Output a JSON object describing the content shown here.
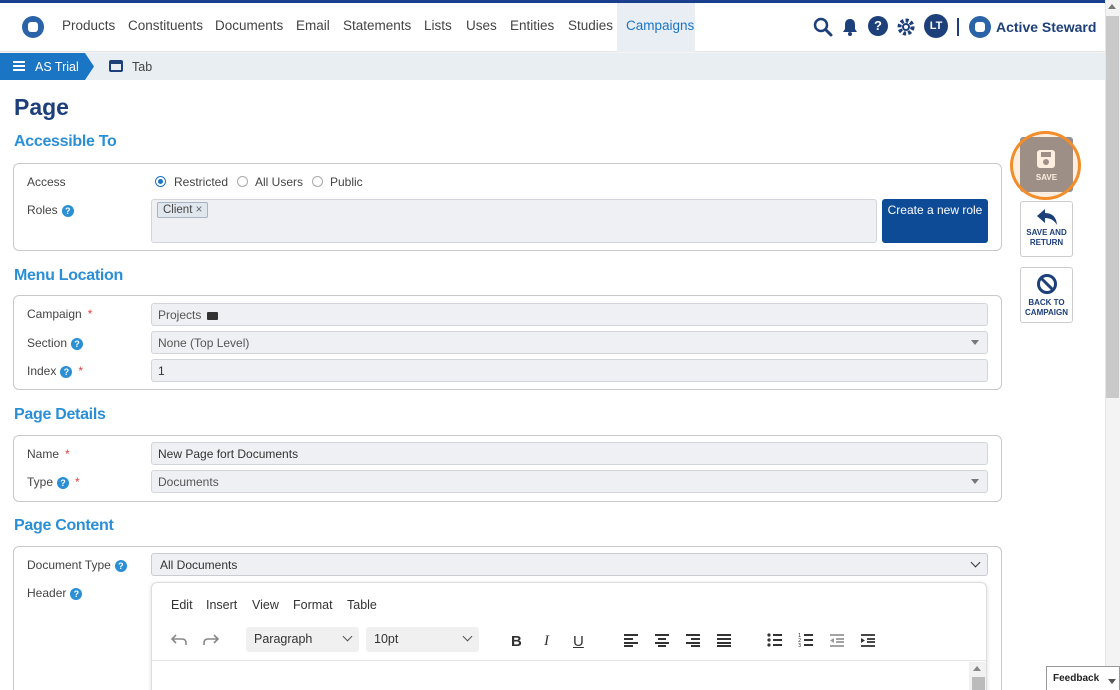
{
  "nav": {
    "items": [
      "Products",
      "Constituents",
      "Documents",
      "Email",
      "Statements",
      "Lists",
      "Uses",
      "Entities",
      "Studies",
      "Campaigns"
    ],
    "active": "Campaigns",
    "avatar": "LT",
    "brand": "Active Steward"
  },
  "breadcrumb": {
    "root": "AS Trial",
    "current": "Tab"
  },
  "page": {
    "title": "Page"
  },
  "accessible": {
    "heading": "Accessible To",
    "access_label": "Access",
    "options": [
      "Restricted",
      "All Users",
      "Public"
    ],
    "selected": "Restricted",
    "roles_label": "Roles",
    "role_tag": "Client",
    "create_role": "Create a new role"
  },
  "menu": {
    "heading": "Menu Location",
    "campaign_label": "Campaign",
    "campaign_value": "Projects",
    "section_label": "Section",
    "section_value": "None (Top Level)",
    "index_label": "Index",
    "index_value": "1"
  },
  "details": {
    "heading": "Page Details",
    "name_label": "Name",
    "name_value": "New Page fort Documents",
    "type_label": "Type",
    "type_value": "Documents"
  },
  "content": {
    "heading": "Page Content",
    "doctype_label": "Document Type",
    "doctype_value": "All Documents",
    "header_label": "Header",
    "editor_menu": [
      "Edit",
      "Insert",
      "View",
      "Format",
      "Table"
    ],
    "block_format": "Paragraph",
    "font_size": "10pt"
  },
  "actions": {
    "save": "SAVE",
    "save_return_1": "SAVE AND",
    "save_return_2": "RETURN",
    "back_1": "BACK TO",
    "back_2": "CAMPAIGN"
  },
  "feedback": "Feedback",
  "colors": {
    "primary": "#1d3f7a",
    "accent": "#2b8fd6",
    "highlight": "#f28d2a"
  }
}
